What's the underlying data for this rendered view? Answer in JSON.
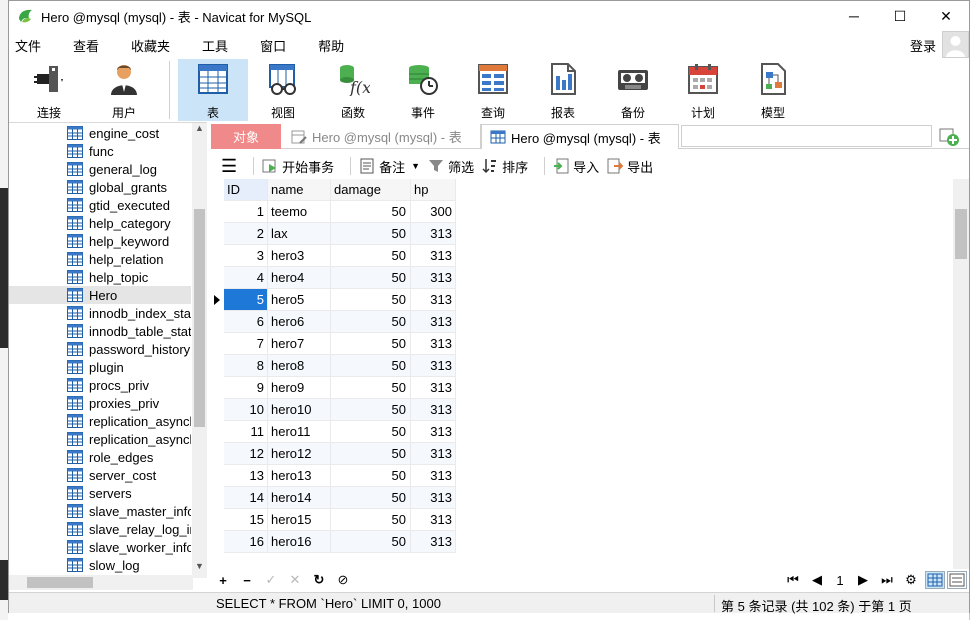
{
  "window": {
    "title": "Hero @mysql (mysql) - 表 - Navicat for MySQL",
    "minimize": "─",
    "maximize": "☐",
    "close": "✕"
  },
  "menu": [
    "文件",
    "查看",
    "收藏夹",
    "工具",
    "窗口",
    "帮助"
  ],
  "login_label": "登录",
  "toolbar": [
    {
      "label": "连接",
      "icon": "plug-icon"
    },
    {
      "label": "用户",
      "icon": "user-icon"
    },
    {
      "label": "表",
      "icon": "table-icon",
      "active": true
    },
    {
      "label": "视图",
      "icon": "view-icon"
    },
    {
      "label": "函数",
      "icon": "function-icon"
    },
    {
      "label": "事件",
      "icon": "event-icon"
    },
    {
      "label": "查询",
      "icon": "query-icon"
    },
    {
      "label": "报表",
      "icon": "report-icon"
    },
    {
      "label": "备份",
      "icon": "backup-icon"
    },
    {
      "label": "计划",
      "icon": "schedule-icon"
    },
    {
      "label": "模型",
      "icon": "model-icon"
    }
  ],
  "sidebar": {
    "tables": [
      "engine_cost",
      "func",
      "general_log",
      "global_grants",
      "gtid_executed",
      "help_category",
      "help_keyword",
      "help_relation",
      "help_topic",
      "Hero",
      "innodb_index_stats",
      "innodb_table_stats",
      "password_history",
      "plugin",
      "procs_priv",
      "proxies_priv",
      "replication_asynchronous_connection_failover",
      "replication_asynchronous_connection_failover_managed",
      "role_edges",
      "server_cost",
      "servers",
      "slave_master_info",
      "slave_relay_log_info",
      "slave_worker_info",
      "slow_log"
    ],
    "selected": "Hero"
  },
  "tabs": {
    "objects": "对象",
    "tab1": "Hero @mysql (mysql) - 表",
    "tab2": "Hero @mysql (mysql) - 表"
  },
  "table_toolbar": {
    "begin_tx": "开始事务",
    "memo": "备注",
    "filter": "筛选",
    "sort": "排序",
    "import": "导入",
    "export": "导出"
  },
  "grid": {
    "columns": [
      "ID",
      "name",
      "damage",
      "hp"
    ],
    "rows": [
      [
        "1",
        "teemo",
        "50",
        "300"
      ],
      [
        "2",
        "lax",
        "50",
        "313"
      ],
      [
        "3",
        "hero3",
        "50",
        "313"
      ],
      [
        "4",
        "hero4",
        "50",
        "313"
      ],
      [
        "5",
        "hero5",
        "50",
        "313"
      ],
      [
        "6",
        "hero6",
        "50",
        "313"
      ],
      [
        "7",
        "hero7",
        "50",
        "313"
      ],
      [
        "8",
        "hero8",
        "50",
        "313"
      ],
      [
        "9",
        "hero9",
        "50",
        "313"
      ],
      [
        "10",
        "hero10",
        "50",
        "313"
      ],
      [
        "11",
        "hero11",
        "50",
        "313"
      ],
      [
        "12",
        "hero12",
        "50",
        "313"
      ],
      [
        "13",
        "hero13",
        "50",
        "313"
      ],
      [
        "14",
        "hero14",
        "50",
        "313"
      ],
      [
        "15",
        "hero15",
        "50",
        "313"
      ],
      [
        "16",
        "hero16",
        "50",
        "313"
      ]
    ],
    "selected_row": 4
  },
  "nav": {
    "add": "+",
    "delete": "−",
    "apply": "✓",
    "discard": "✕",
    "refresh": "↻",
    "stop": "⊘",
    "first": "⏮",
    "prev": "◀",
    "page": "1",
    "next": "▶",
    "last": "⏭",
    "settings": "⚙"
  },
  "status": {
    "sql": "SELECT * FROM `Hero` LIMIT 0, 1000",
    "record": "第 5 条记录 (共 102 条) 于第 1 页"
  },
  "colors": {
    "accent": "#1e78d7",
    "objects_tab": "#f08a8a",
    "toolbar_active": "#cce4f7"
  }
}
